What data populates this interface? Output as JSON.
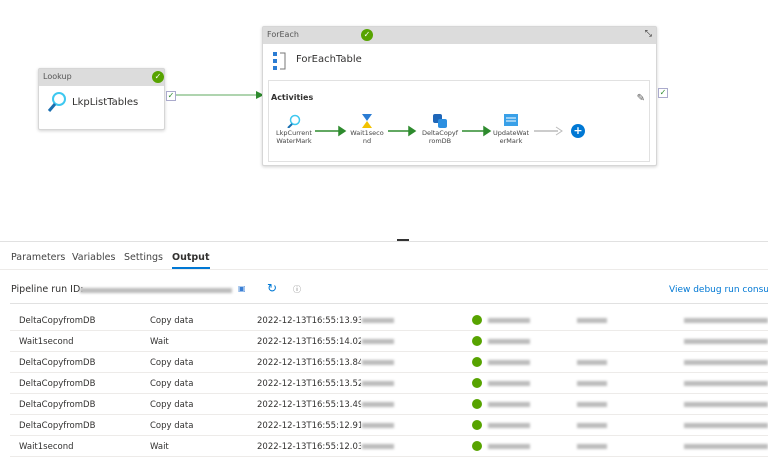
{
  "canvas": {
    "lookup": {
      "type": "Lookup",
      "name": "LkpListTables"
    },
    "foreach": {
      "type": "ForEach",
      "name": "ForEachTable",
      "activities_label": "Activities",
      "activities": [
        {
          "name": "LkpCurrent WaterMark",
          "icon": "search-icon"
        },
        {
          "name": "Wait1seco nd",
          "icon": "hourglass-icon"
        },
        {
          "name": "DeltaCopyf romDB",
          "icon": "database-copy-icon"
        },
        {
          "name": "UpdateWat erMark",
          "icon": "stored-procedure-icon"
        }
      ]
    }
  },
  "panel": {
    "tabs": [
      "Parameters",
      "Variables",
      "Settings",
      "Output"
    ],
    "active_tab": "Output",
    "run_id_label": "Pipeline run ID:",
    "debug_link": "View debug run consump",
    "rows": [
      {
        "name": "DeltaCopyfromDB",
        "type": "Copy data",
        "start": "2022-12-13T16:55:13.933"
      },
      {
        "name": "Wait1second",
        "type": "Wait",
        "start": "2022-12-13T16:55:14.026"
      },
      {
        "name": "DeltaCopyfromDB",
        "type": "Copy data",
        "start": "2022-12-13T16:55:13.840"
      },
      {
        "name": "DeltaCopyfromDB",
        "type": "Copy data",
        "start": "2022-12-13T16:55:13.522"
      },
      {
        "name": "DeltaCopyfromDB",
        "type": "Copy data",
        "start": "2022-12-13T16:55:13.494"
      },
      {
        "name": "DeltaCopyfromDB",
        "type": "Copy data",
        "start": "2022-12-13T16:55:12.916"
      },
      {
        "name": "Wait1second",
        "type": "Wait",
        "start": "2022-12-13T16:55:12.032"
      }
    ]
  },
  "colors": {
    "accent": "#0078d4",
    "success": "#57a300",
    "arrow": "#2e8b2e"
  }
}
